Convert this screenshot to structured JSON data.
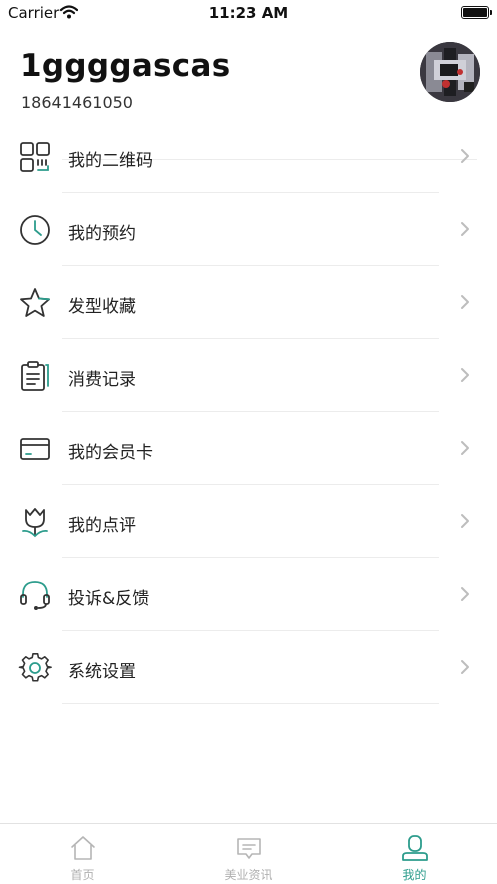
{
  "status_bar": {
    "carrier": "Carrier",
    "time": "11:23 AM"
  },
  "profile": {
    "username": "1ggggascas",
    "phone": "18641461050"
  },
  "menu": {
    "items": [
      {
        "label": "我的二维码",
        "icon": "qr-code-icon"
      },
      {
        "label": "我的预约",
        "icon": "clock-icon"
      },
      {
        "label": "发型收藏",
        "icon": "star-icon"
      },
      {
        "label": "消费记录",
        "icon": "clipboard-icon"
      },
      {
        "label": "我的会员卡",
        "icon": "card-icon"
      },
      {
        "label": "我的点评",
        "icon": "tulip-icon"
      },
      {
        "label": "投诉&反馈",
        "icon": "headset-icon"
      },
      {
        "label": "系统设置",
        "icon": "gear-icon"
      }
    ]
  },
  "tabbar": {
    "tabs": [
      {
        "label": "首页",
        "icon": "home-icon",
        "active": false
      },
      {
        "label": "美业资讯",
        "icon": "message-icon",
        "active": false
      },
      {
        "label": "我的",
        "icon": "user-icon",
        "active": true
      }
    ]
  },
  "colors": {
    "accent": "#2c9c8c",
    "inactive": "#b0b0b0",
    "divider": "#ececec"
  }
}
